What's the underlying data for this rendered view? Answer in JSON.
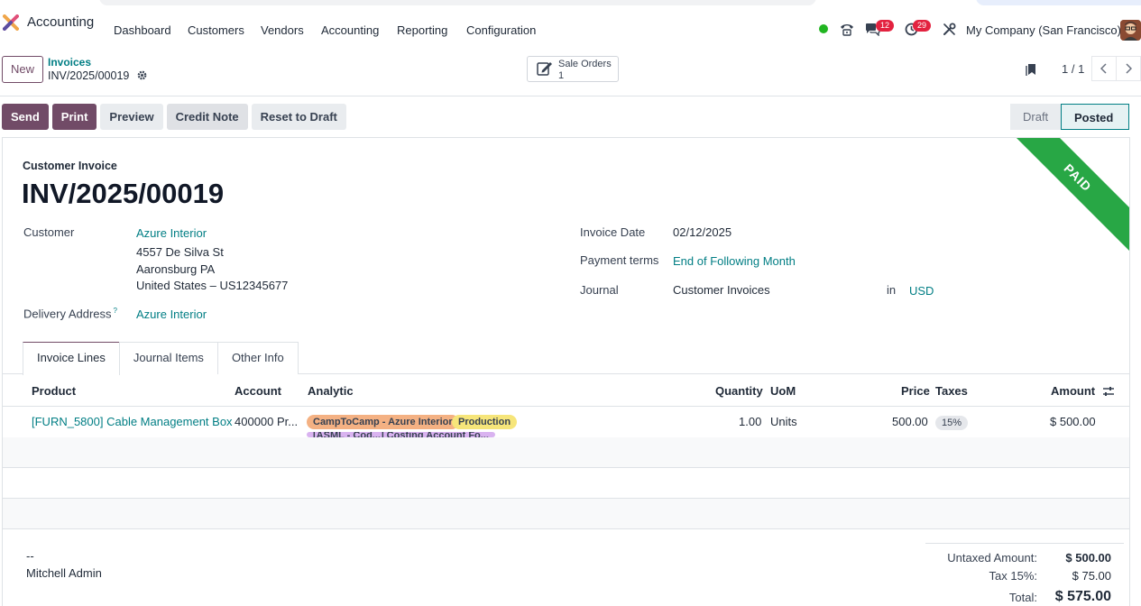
{
  "app": {
    "name": "Accounting"
  },
  "menu": [
    "Dashboard",
    "Customers",
    "Vendors",
    "Accounting",
    "Reporting",
    "Configuration"
  ],
  "systray": {
    "messages_count": "12",
    "activities_count": "29",
    "company": "My Company (San Francisco)"
  },
  "control": {
    "new_label": "New",
    "breadcrumb_parent": "Invoices",
    "breadcrumb_current": "INV/2025/00019",
    "smart_button": {
      "title": "Sale Orders",
      "count": "1"
    },
    "pager": "1 / 1"
  },
  "actions": [
    "Send",
    "Print",
    "Preview",
    "Credit Note",
    "Reset to Draft"
  ],
  "statusbar": {
    "draft": "Draft",
    "posted": "Posted"
  },
  "ribbon": "PAID",
  "invoice": {
    "type": "Customer Invoice",
    "name": "INV/2025/00019",
    "customer_label": "Customer",
    "customer": "Azure Interior",
    "address1": "4557 De Silva St",
    "address2": "Aaronsburg PA",
    "address3": "United States – US12345677",
    "delivery_label": "Delivery Address",
    "delivery_help": "?",
    "delivery": "Azure Interior",
    "date_label": "Invoice Date",
    "date": "02/12/2025",
    "terms_label": "Payment terms",
    "terms": "End of Following Month",
    "journal_label": "Journal",
    "journal": "Customer Invoices",
    "in_label": "in",
    "currency": "USD"
  },
  "tabs": [
    "Invoice Lines",
    "Journal Items",
    "Other Info"
  ],
  "table": {
    "headers": {
      "product": "Product",
      "account": "Account",
      "analytic": "Analytic",
      "quantity": "Quantity",
      "uom": "UoM",
      "price": "Price",
      "taxes": "Taxes",
      "amount": "Amount"
    },
    "rows": [
      {
        "product": "[FURN_5800] Cable Management Box",
        "account": "400000 Pr...",
        "analytic_tags": [
          "CampToCamp - Azure Interior",
          "Production",
          "[ASML - Cod...] Costing Account Fo..."
        ],
        "quantity": "1.00",
        "uom": "Units",
        "price": "500.00",
        "tax": "15%",
        "amount": "$ 500.00"
      }
    ]
  },
  "notes": {
    "line1": "--",
    "line2": "Mitchell Admin"
  },
  "totals": {
    "untaxed_label": "Untaxed Amount:",
    "untaxed": "$ 500.00",
    "tax_label": "Tax 15%:",
    "tax": "$ 75.00",
    "total_label": "Total:",
    "total": "$ 575.00"
  },
  "colors": {
    "brand": "#714b67",
    "link": "#017e84",
    "paid_ribbon": "#28a745",
    "badge": "#e3223f"
  }
}
